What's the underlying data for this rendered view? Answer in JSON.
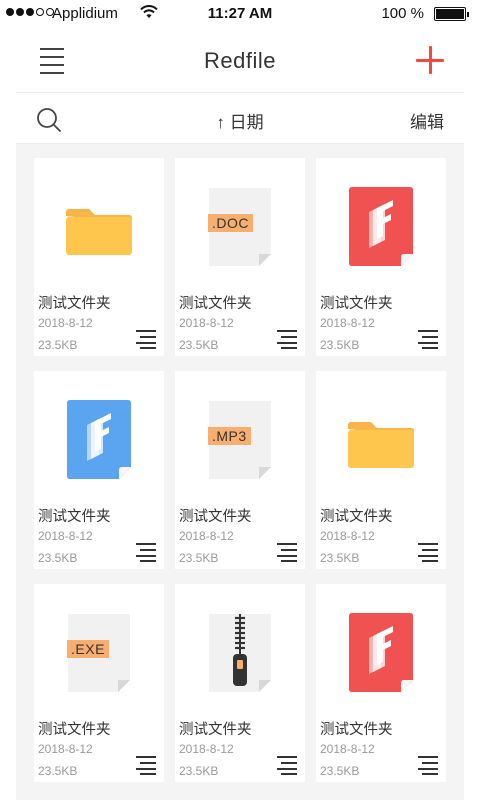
{
  "status_bar": {
    "carrier": "Applidium",
    "time": "11:27 AM",
    "battery": "100 %"
  },
  "nav": {
    "title": "Redfile"
  },
  "toolbar": {
    "sort_arrow": "↑",
    "sort_label": "日期",
    "edit_label": "编辑"
  },
  "files": [
    {
      "name": "测试文件夹",
      "date": "2018-8-12",
      "size": "23.5KB",
      "icon": "folder-icon"
    },
    {
      "name": "测试文件夹",
      "date": "2018-8-12",
      "size": "23.5KB",
      "icon": "doc-file-icon",
      "ext": ".DOC"
    },
    {
      "name": "测试文件夹",
      "date": "2018-8-12",
      "size": "23.5KB",
      "icon": "red-app-file-icon"
    },
    {
      "name": "测试文件夹",
      "date": "2018-8-12",
      "size": "23.5KB",
      "icon": "blue-app-file-icon"
    },
    {
      "name": "测试文件夹",
      "date": "2018-8-12",
      "size": "23.5KB",
      "icon": "mp3-file-icon",
      "ext": ".MP3"
    },
    {
      "name": "测试文件夹",
      "date": "2018-8-12",
      "size": "23.5KB",
      "icon": "folder-icon"
    },
    {
      "name": "测试文件夹",
      "date": "2018-8-12",
      "size": "23.5KB",
      "icon": "exe-file-icon",
      "ext": ".EXE"
    },
    {
      "name": "测试文件夹",
      "date": "2018-8-12",
      "size": "23.5KB",
      "icon": "zip-file-icon"
    },
    {
      "name": "测试文件夹",
      "date": "2018-8-12",
      "size": "23.5KB",
      "icon": "red-app-file-icon"
    }
  ],
  "colors": {
    "accent": "#f04a3e",
    "folder": "#ffc64e",
    "red_app": "#f05252",
    "blue_app": "#5ba4ef",
    "ext_label": "#f7ae6e"
  }
}
